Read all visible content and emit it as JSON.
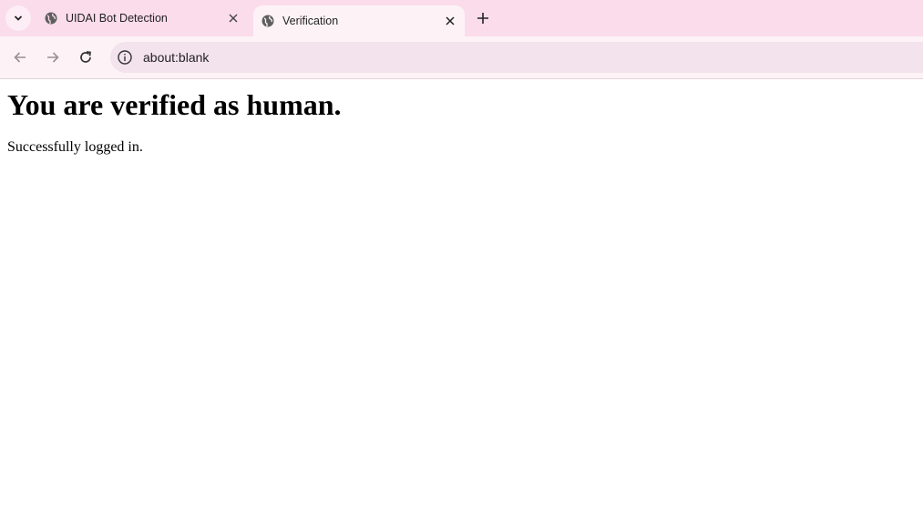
{
  "browser": {
    "tabs": [
      {
        "title": "UIDAI Bot Detection",
        "active": false
      },
      {
        "title": "Verification",
        "active": true
      }
    ],
    "address": "about:blank"
  },
  "page": {
    "heading": "You are verified as human.",
    "message": "Successfully logged in."
  },
  "colors": {
    "tabstrip": "#fbdcea",
    "toolbar": "#fdf3f7",
    "omnibox": "#f3e3ec"
  }
}
